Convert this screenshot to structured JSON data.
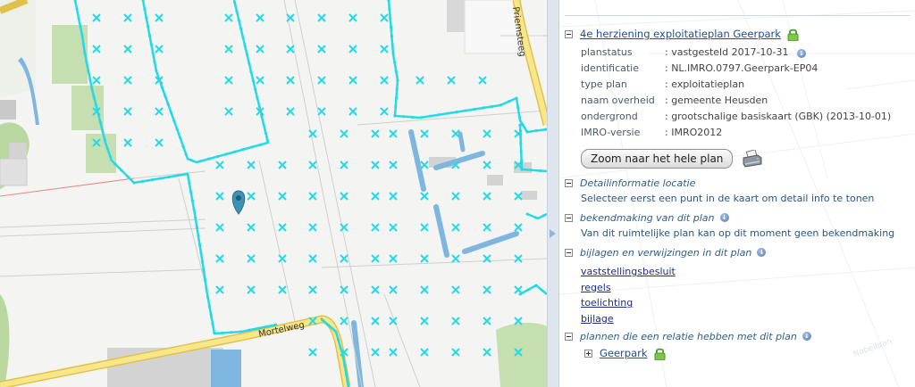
{
  "map": {
    "streets": {
      "priemsteeg": "Priemsteeg",
      "mortelweg": "Mortelweg",
      "nobellaan": "Nobellaan"
    }
  },
  "panel": {
    "plan": {
      "title": "4e herziening exploitatieplan Geerpark",
      "properties": [
        {
          "key": "planstatus",
          "value": "vastgesteld 2017-10-31"
        },
        {
          "key": "identificatie",
          "value": "NL.IMRO.0797.Geerpark-EP04"
        },
        {
          "key": "type plan",
          "value": "exploitatieplan"
        },
        {
          "key": "naam overheid",
          "value": "gemeente Heusden"
        },
        {
          "key": "ondergrond",
          "value": "grootschalige basiskaart (GBK) (2013-10-01)"
        },
        {
          "key": "IMRO-versie",
          "value": "IMRO2012"
        }
      ],
      "zoom_button": "Zoom naar het hele plan"
    },
    "detail": {
      "title": "Detailinformatie locatie",
      "text": "Selecteer eerst een punt in de kaart om detail info te tonen"
    },
    "bekendmaking": {
      "title": "bekendmaking van dit plan",
      "text": "Van dit ruimtelijke plan kan op dit moment geen bekendmaking"
    },
    "bijlagen": {
      "title": "bijlagen en verwijzingen in dit plan",
      "links": [
        "vaststellingsbesluit",
        "regels",
        "toelichting",
        "bijlage"
      ]
    },
    "relaties": {
      "title": "plannen die een relatie hebben met dit plan",
      "child": "Geerpark"
    }
  },
  "colors": {
    "plan_outline": "#25d9e6",
    "water": "#7eb6e0",
    "green": "#a9cf8f",
    "road_yellow": "#f5dc5a",
    "marker": "#3e93b4"
  }
}
